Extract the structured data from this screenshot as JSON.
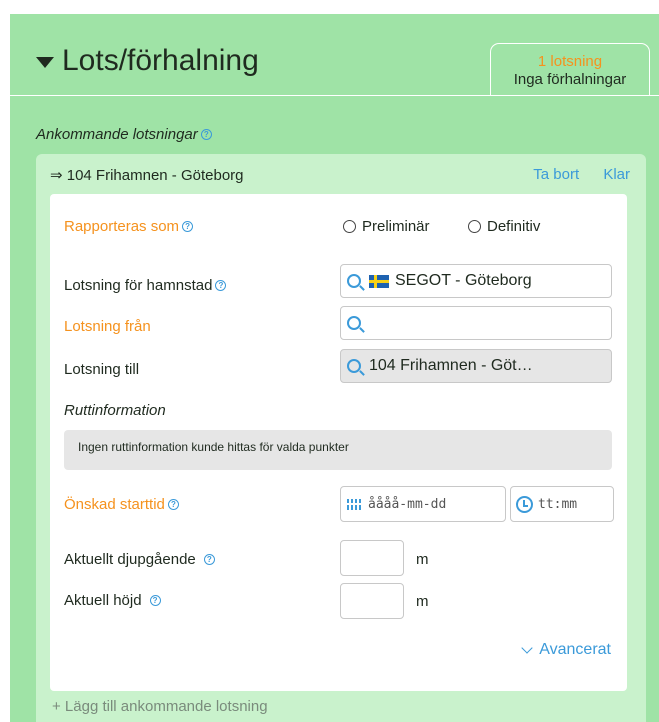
{
  "header": {
    "title": "Lots/förhalning",
    "tab": {
      "line1": "1 lotsning",
      "line2": "Inga förhalningar"
    }
  },
  "section": {
    "label": "Ankommande lotsningar"
  },
  "pilotage": {
    "heading": "⇒ 104 Frihamnen - Göteborg",
    "remove_label": "Ta bort",
    "done_label": "Klar",
    "report_as": {
      "label": "Rapporteras som",
      "options": [
        "Preliminär",
        "Definitiv"
      ]
    },
    "port_city": {
      "label": "Lotsning för hamnstad",
      "value": "SEGOT - Göteborg"
    },
    "from": {
      "label": "Lotsning från",
      "value": ""
    },
    "to": {
      "label": "Lotsning till",
      "value": "104 Frihamnen - Göt…"
    },
    "route": {
      "label": "Ruttinformation",
      "message": "Ingen ruttinformation kunde hittas för valda punkter"
    },
    "start_time": {
      "label": "Önskad starttid",
      "date_placeholder": "åååå-mm-dd",
      "time_placeholder": "tt:mm"
    },
    "draught": {
      "label": "Aktuellt djupgående",
      "unit": "m"
    },
    "height": {
      "label": "Aktuell höjd",
      "unit": "m"
    },
    "advanced_label": "Avancerat"
  },
  "add_link": "+ Lägg till ankommande lotsning",
  "colors": {
    "panel_green": "#9fe3a6",
    "inner_green": "#c9f2cc",
    "accent_orange": "#f5921e",
    "link_blue": "#3b9ad9"
  }
}
